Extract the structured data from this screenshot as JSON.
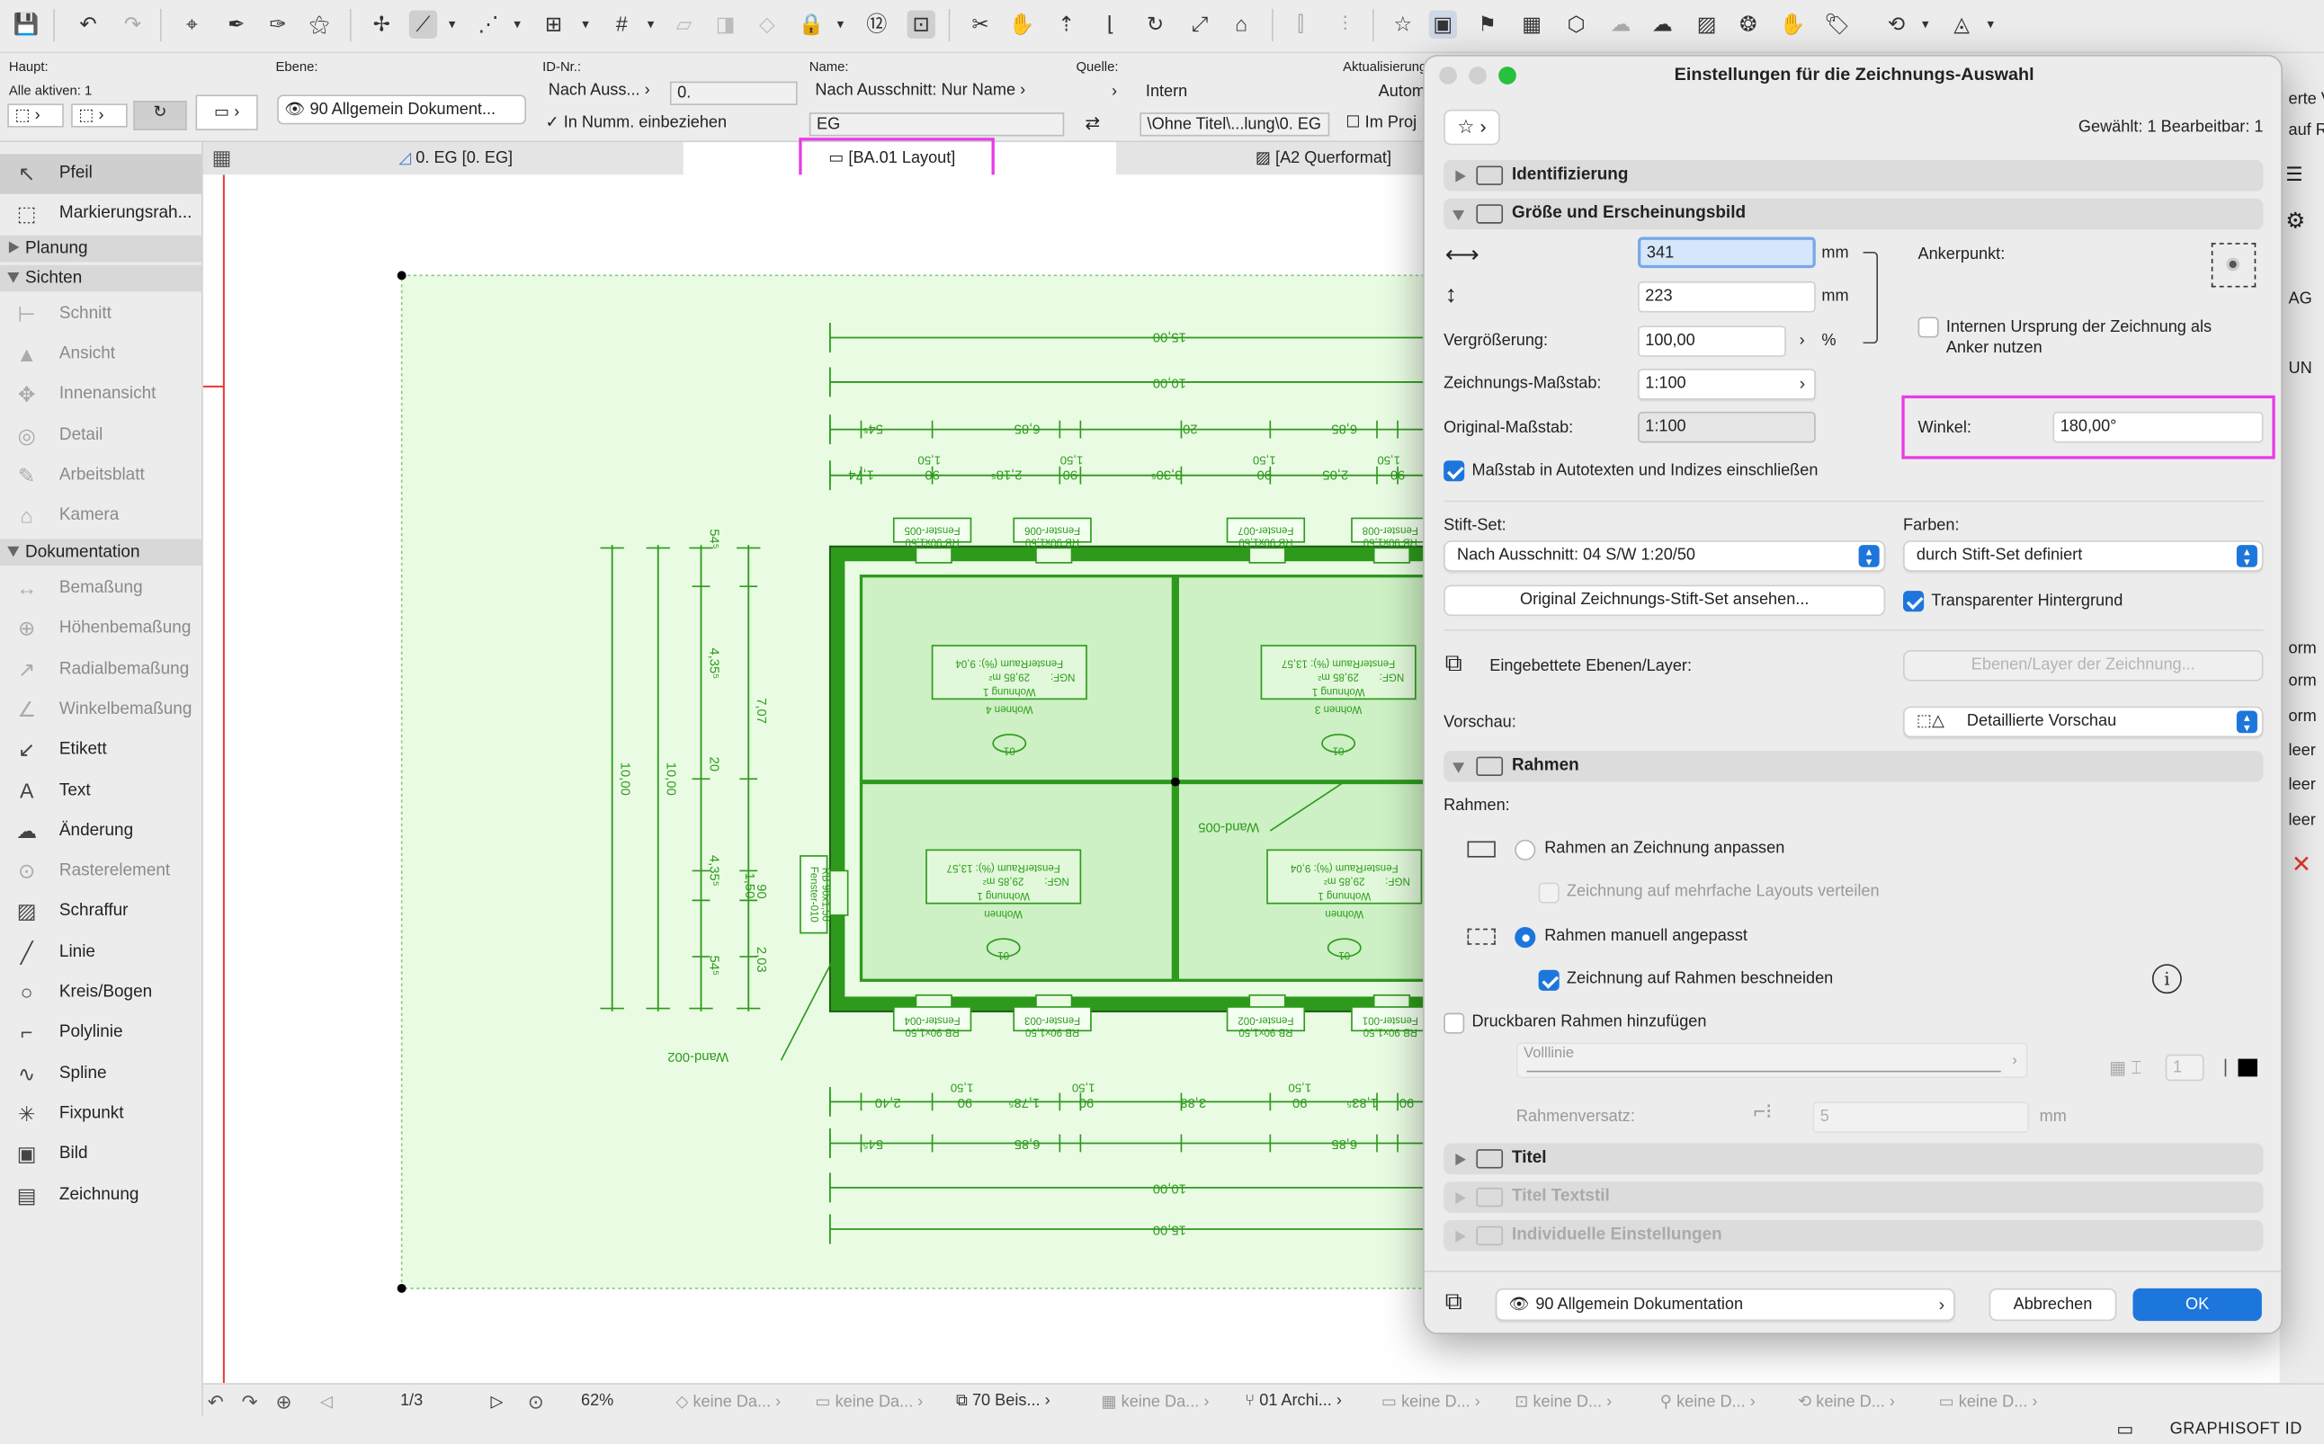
{
  "info_box": {
    "haupt_label": "Haupt:",
    "alle_aktiven": "Alle aktiven: 1",
    "ebene_label": "Ebene:",
    "ebene_value": "90 Allgemein Dokument...",
    "id_label": "ID-Nr.:",
    "id_mode": "Nach Auss...",
    "id_value": "0.",
    "in_numm": "In Numm. einbeziehen",
    "name_label": "Name:",
    "name_mode": "Nach Ausschnitt: Nur Name",
    "name_value": "EG",
    "quelle_label": "Quelle:",
    "quelle_value": "Intern",
    "quelle_path": "\\Ohne Titel\\...lung\\0. EG",
    "aktual_label": "Aktualisierung:",
    "aktual_value": "Autom",
    "im_proj": "Im Proj"
  },
  "tabs": [
    {
      "label": "0. EG [0. EG]"
    },
    {
      "label": "[BA.01 Layout]"
    },
    {
      "label": "[A2 Querformat]"
    }
  ],
  "sidebar": {
    "items": [
      {
        "label": "Pfeil",
        "icon": "↖"
      },
      {
        "label": "Markierungsrah...",
        "icon": "⬚"
      }
    ],
    "groups": [
      {
        "label": "Planung"
      },
      {
        "label": "Sichten"
      },
      {
        "label": "Dokumentation"
      }
    ],
    "sichten": [
      {
        "label": "Schnitt",
        "icon": "⊢"
      },
      {
        "label": "Ansicht",
        "icon": "▲"
      },
      {
        "label": "Innenansicht",
        "icon": "✥"
      },
      {
        "label": "Detail",
        "icon": "◎"
      },
      {
        "label": "Arbeitsblatt",
        "icon": "✎"
      },
      {
        "label": "Kamera",
        "icon": "⌂"
      }
    ],
    "doku": [
      {
        "label": "Bemaßung",
        "icon": "↔",
        "dim": true
      },
      {
        "label": "Höhenbemaßung",
        "icon": "⊕",
        "dim": true
      },
      {
        "label": "Radialbemaßung",
        "icon": "↗",
        "dim": true
      },
      {
        "label": "Winkelbemaßung",
        "icon": "∠",
        "dim": true
      },
      {
        "label": "Etikett",
        "icon": "↙",
        "dim": false
      },
      {
        "label": "Text",
        "icon": "A",
        "dim": false
      },
      {
        "label": "Änderung",
        "icon": "☁",
        "dim": false
      },
      {
        "label": "Rasterelement",
        "icon": "⊙",
        "dim": true
      },
      {
        "label": "Schraffur",
        "icon": "▨",
        "dim": false
      },
      {
        "label": "Linie",
        "icon": "╱",
        "dim": false
      },
      {
        "label": "Kreis/Bogen",
        "icon": "○",
        "dim": false
      },
      {
        "label": "Polylinie",
        "icon": "⌐",
        "dim": false
      },
      {
        "label": "Spline",
        "icon": "∿",
        "dim": false
      },
      {
        "label": "Fixpunkt",
        "icon": "✳",
        "dim": false
      },
      {
        "label": "Bild",
        "icon": "▣",
        "dim": false
      },
      {
        "label": "Zeichnung",
        "icon": "▤",
        "dim": false
      }
    ]
  },
  "plan": {
    "dims_top": [
      "15,00",
      "10,00",
      "6,85",
      "6,85",
      "54⁵",
      "20",
      "1,74",
      "90",
      "2,18⁵",
      "90",
      "3,30⁵",
      "90",
      "2,05",
      "90",
      "1,50",
      "1,50",
      "1,50",
      "1,50"
    ],
    "dims_bottom": [
      "2,40",
      "90",
      "1,78⁵",
      "90",
      "3,88",
      "90",
      "1,83⁵",
      "90",
      "1,50",
      "1,50",
      "1,50",
      "6,85",
      "6,85",
      "54⁵",
      "15,00",
      "10,00"
    ],
    "dims_left": [
      "10,00",
      "10,00",
      "7,07",
      "4,35⁵",
      "4,35⁵",
      "20",
      "54⁵",
      "54⁵",
      "1,50",
      "90",
      "2,03"
    ],
    "windows_top": [
      "Fenster-005",
      "Fenster-006",
      "Fenster-007",
      "Fenster-008"
    ],
    "windows_bottom": [
      "Fenster-004",
      "Fenster-003",
      "Fenster-002",
      "Fenster-001"
    ],
    "window_size": "RB 90x1,50",
    "window_left": "Fenster-010",
    "rooms": [
      {
        "name": "Wohnen 4",
        "unit": "Wohnung 1",
        "area": "29,85 m²",
        "ngf": "NGF:",
        "fenster": "FensterRaum (%): 9,04",
        "tag": "01"
      },
      {
        "name": "Wohnen 3",
        "unit": "Wohnung 1",
        "area": "29,85 m²",
        "ngf": "NGF:",
        "fenster": "FensterRaum (%): 13,57",
        "tag": "01"
      },
      {
        "name": "Wohnen",
        "unit": "Wohnung 1",
        "area": "29,85 m²",
        "ngf": "NGF:",
        "fenster": "FensterRaum (%): 13,57",
        "tag": "01"
      },
      {
        "name": "Wohnen",
        "unit": "Wohnung 1",
        "area": "29,85 m²",
        "ngf": "NGF:",
        "fenster": "FensterRaum (%): 9,04",
        "tag": "01"
      }
    ],
    "wand_labels": [
      "Wand-005",
      "Wand-002"
    ]
  },
  "statusbar": {
    "page": "1/3",
    "zoom": "62%",
    "items": [
      "keine Da...",
      "keine Da...",
      "70 Beis...",
      "keine Da...",
      "01 Archi...",
      "keine D...",
      "keine D...",
      "keine D...",
      "keine D...",
      "keine D..."
    ],
    "brand": "GRAPHISOFT ID"
  },
  "right_partial": [
    "erte Vo",
    "auf R",
    "AG",
    "UN",
    "orm",
    "orm",
    "orm",
    "leer",
    "leer",
    "leer"
  ],
  "dialog": {
    "title": "Einstellungen für die Zeichnungs-Auswahl",
    "selection": "Gewählt: 1 Bearbeitbar: 1",
    "sections": {
      "identifizierung": "Identifizierung",
      "groesse": "Größe und Erscheinungsbild",
      "rahmen": "Rahmen",
      "titel": "Titel",
      "titel_textstil": "Titel Textstil",
      "individuelle": "Individuelle Einstellungen"
    },
    "width_value": "341",
    "height_value": "223",
    "unit_mm": "mm",
    "vergroesserung_label": "Vergrößerung:",
    "vergroesserung_value": "100,00",
    "unit_percent": "%",
    "zeichnungs_massstab_label": "Zeichnungs-Maßstab:",
    "zeichnungs_massstab_value": "1:100",
    "original_massstab_label": "Original-Maßstab:",
    "original_massstab_value": "1:100",
    "ankerpunkt_label": "Ankerpunkt:",
    "internen_ursprung": "Internen Ursprung der Zeichnung als Anker nutzen",
    "winkel_label": "Winkel:",
    "winkel_value": "180,00°",
    "massstab_check": "Maßstab in Autotexten und Indizes einschließen",
    "stift_set_label": "Stift-Set:",
    "stift_set_value": "Nach Ausschnitt: 04 S/W 1:20/50",
    "farben_label": "Farben:",
    "farben_value": "durch Stift-Set definiert",
    "original_stift_button": "Original Zeichnungs-Stift-Set ansehen...",
    "transparent_check": "Transparenter Hintergrund",
    "eingebettete_label": "Eingebettete Ebenen/Layer:",
    "ebenen_button": "Ebenen/Layer der Zeichnung...",
    "vorschau_label": "Vorschau:",
    "vorschau_value": "Detaillierte Vorschau",
    "rahmen_label": "Rahmen:",
    "rahmen_anpassen": "Rahmen an Zeichnung anpassen",
    "mehrfache_layouts": "Zeichnung auf mehrfache Layouts verteilen",
    "rahmen_manuell": "Rahmen manuell angepasst",
    "beschneiden": "Zeichnung auf Rahmen beschneiden",
    "druckbaren": "Druckbaren Rahmen hinzufügen",
    "volllinie": "Volllinie",
    "pen_value": "1",
    "rahmenversatz_label": "Rahmenversatz:",
    "rahmenversatz_value": "5",
    "layer_value": "90 Allgemein Dokumentation",
    "cancel": "Abbrechen",
    "ok": "OK"
  },
  "colors": {
    "accent": "#1d76db",
    "highlight": "#e83be6",
    "plan_green": "#2d9a1c",
    "plan_fill": "#e9fbe3"
  }
}
